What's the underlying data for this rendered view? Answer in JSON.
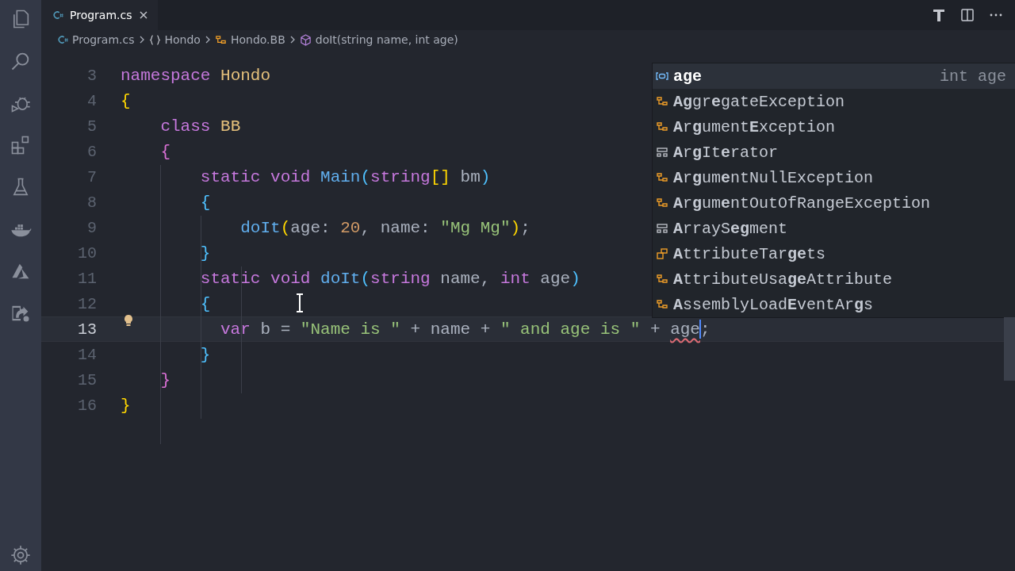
{
  "activity_bar": {
    "items": [
      {
        "kind": "files",
        "selected": false
      },
      {
        "kind": "search",
        "selected": false
      },
      {
        "kind": "debug",
        "selected": false
      },
      {
        "kind": "extensions",
        "selected": false
      },
      {
        "kind": "flask",
        "selected": false
      },
      {
        "kind": "whale",
        "selected": false
      },
      {
        "kind": "azure",
        "selected": false
      },
      {
        "kind": "share",
        "selected": false
      }
    ]
  },
  "tabs": [
    {
      "label": "Program.cs",
      "selected": true
    }
  ],
  "breadcrumbs": [
    {
      "kind": "file",
      "label": "Program.cs"
    },
    {
      "kind": "namespace",
      "label": "Hondo"
    },
    {
      "kind": "class",
      "label": "Hondo.BB"
    },
    {
      "kind": "method",
      "label": "doIt(string name, int age)"
    }
  ],
  "editor": {
    "lines": [
      {
        "number": "3",
        "current": false,
        "lightbulb": false,
        "tokens": [
          {
            "kind": "keyword",
            "text": "namespace"
          },
          {
            "kind": "type",
            "text": " Hondo"
          }
        ]
      },
      {
        "number": "4",
        "current": false,
        "lightbulb": false,
        "tokens": [
          {
            "kind": "bracket1",
            "text": "{"
          }
        ]
      },
      {
        "number": "5",
        "current": false,
        "lightbulb": false,
        "tokens": [
          {
            "kind": "keyword",
            "text": "    class"
          },
          {
            "kind": "type",
            "text": " BB"
          }
        ]
      },
      {
        "number": "6",
        "current": false,
        "lightbulb": false,
        "tokens": [
          {
            "kind": "bracket2",
            "text": "    {"
          }
        ]
      },
      {
        "number": "7",
        "current": false,
        "lightbulb": false,
        "tokens": [
          {
            "kind": "keyword",
            "text": "        static void"
          },
          {
            "kind": "function",
            "text": " Main"
          },
          {
            "kind": "bracket3",
            "text": "("
          },
          {
            "kind": "keyword",
            "text": "string"
          },
          {
            "kind": "bracket1",
            "text": "[]"
          },
          {
            "kind": "plain",
            "text": " bm"
          },
          {
            "kind": "bracket3",
            "text": ")"
          }
        ]
      },
      {
        "number": "8",
        "current": false,
        "lightbulb": false,
        "tokens": [
          {
            "kind": "bracket3",
            "text": "        {"
          }
        ]
      },
      {
        "number": "9",
        "current": false,
        "lightbulb": false,
        "tokens": [
          {
            "kind": "function",
            "text": "            doIt"
          },
          {
            "kind": "bracket1",
            "text": "("
          },
          {
            "kind": "plain",
            "text": "age: "
          },
          {
            "kind": "number",
            "text": "20"
          },
          {
            "kind": "plain",
            "text": ", name: "
          },
          {
            "kind": "string",
            "text": "\"Mg Mg\""
          },
          {
            "kind": "bracket1",
            "text": ")"
          },
          {
            "kind": "plain",
            "text": ";"
          }
        ]
      },
      {
        "number": "10",
        "current": false,
        "lightbulb": false,
        "tokens": [
          {
            "kind": "bracket3",
            "text": "        }"
          }
        ]
      },
      {
        "number": "11",
        "current": false,
        "lightbulb": false,
        "tokens": [
          {
            "kind": "keyword",
            "text": "        static void"
          },
          {
            "kind": "function",
            "text": " doIt"
          },
          {
            "kind": "bracket3",
            "text": "("
          },
          {
            "kind": "keyword",
            "text": "string"
          },
          {
            "kind": "plain",
            "text": " name, "
          },
          {
            "kind": "keyword",
            "text": "int"
          },
          {
            "kind": "plain",
            "text": " age"
          },
          {
            "kind": "bracket3",
            "text": ")"
          }
        ]
      },
      {
        "number": "12",
        "current": false,
        "lightbulb": false,
        "tokens": [
          {
            "kind": "bracket3",
            "text": "        {"
          }
        ]
      },
      {
        "number": "13",
        "current": true,
        "lightbulb": true,
        "tokens": [
          {
            "kind": "keyword",
            "text": "          var"
          },
          {
            "kind": "plain",
            "text": " b = "
          },
          {
            "kind": "string",
            "text": "\"Name is \""
          },
          {
            "kind": "plain",
            "text": " + name + "
          },
          {
            "kind": "string",
            "text": "\" and age is \""
          },
          {
            "kind": "plain",
            "text": " + "
          },
          {
            "kind": "plain",
            "text": "age",
            "error": true
          },
          {
            "kind": "plain",
            "text": ";"
          }
        ]
      },
      {
        "number": "14",
        "current": false,
        "lightbulb": false,
        "tokens": [
          {
            "kind": "bracket3",
            "text": "        }"
          }
        ]
      },
      {
        "number": "15",
        "current": false,
        "lightbulb": false,
        "tokens": [
          {
            "kind": "bracket2",
            "text": "    }"
          }
        ]
      },
      {
        "number": "16",
        "current": false,
        "lightbulb": false,
        "tokens": [
          {
            "kind": "bracket1",
            "text": "}"
          }
        ]
      }
    ]
  },
  "suggestions": [
    {
      "kind": "variable",
      "label": "age",
      "detail": "int age",
      "selected": true
    },
    {
      "kind": "class",
      "label": "**Ag**gr**e**gateException",
      "selected": false
    },
    {
      "kind": "class",
      "label": "**A**r**g**ument**E**xception",
      "selected": false
    },
    {
      "kind": "struct",
      "label": "**A**r**g**It**e**rator",
      "selected": false
    },
    {
      "kind": "class",
      "label": "**A**r**g**um**e**ntNullException",
      "selected": false
    },
    {
      "kind": "class",
      "label": "**A**r**g**um**e**ntOutOfRangeException",
      "selected": false
    },
    {
      "kind": "struct",
      "label": "**A**rrayS**eg**ment",
      "selected": false
    },
    {
      "kind": "enum",
      "label": "**A**ttributeTar**ge**ts",
      "selected": false
    },
    {
      "kind": "class",
      "label": "**A**ttributeUsa**ge**Attribute",
      "selected": false
    },
    {
      "kind": "class",
      "label": "**A**ssemblyLoad**E**ventAr**g**s",
      "selected": false
    }
  ]
}
